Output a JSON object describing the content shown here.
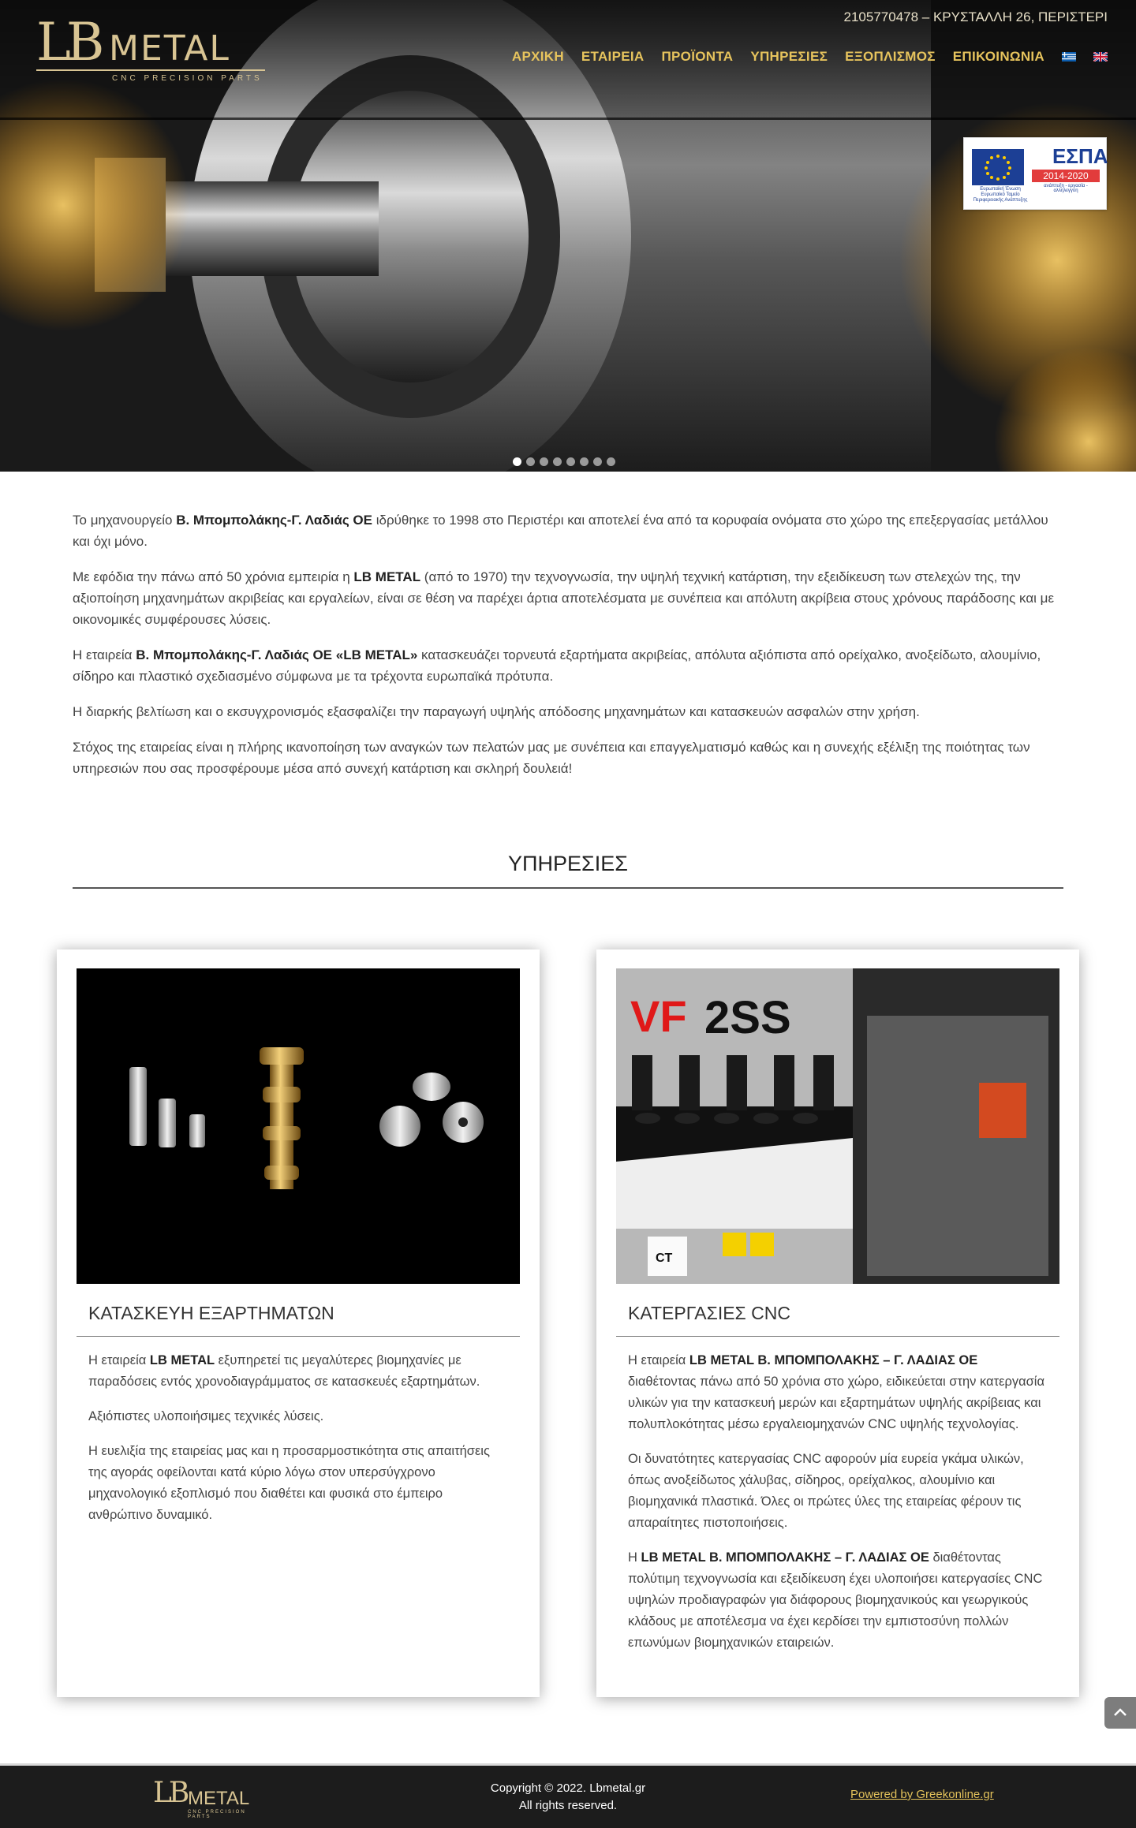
{
  "header": {
    "contact": "2105770478 – ΚΡΥΣΤΑΛΛΗ 26, ΠΕΡΙΣΤΕΡΙ",
    "logo": {
      "mark": "LB",
      "word": "METAL",
      "tagline": "CNC PRECISION PARTS"
    },
    "nav": [
      "ΑΡΧΙΚΗ",
      "ΕΤΑΙΡΕΙΑ",
      "ΠΡΟΪΟΝΤΑ",
      "ΥΠΗΡΕΣΙΕΣ",
      "ΕΞΟΠΛΙΣΜΟΣ",
      "ΕΠΙΚΟΙΝΩΝΙΑ"
    ],
    "languages": [
      "el-flag-icon",
      "en-flag-icon"
    ]
  },
  "espa": {
    "title": "ΕΣΠΑ",
    "years": "2014-2020",
    "eu_caption": "Ευρωπαϊκή Ένωση Ευρωπαϊκό Ταμείο Περιφερειακής Ανάπτυξης",
    "slogan": "ανάπτυξη - εργασία - αλληλεγγύη"
  },
  "slider": {
    "count": 8,
    "active": 0
  },
  "intro": [
    {
      "pre": "Το μηχανουργείο ",
      "bold": "Β. Μπομπολάκης-Γ. Λαδιάς ΟΕ",
      "post": " ιδρύθηκε το 1998 στο Περιστέρι και αποτελεί ένα από τα κορυφαία ονόματα στο χώρο της επεξεργασίας μετάλλου και όχι μόνο."
    },
    {
      "pre": "Με εφόδια την πάνω από 50 χρόνια εμπειρία η ",
      "bold": "LB METAL",
      "post": " (από το 1970) την τεχνογνωσία, την υψηλή τεχνική κατάρτιση, την εξειδίκευση των στελεχών της, την αξιοποίηση μηχανημάτων ακριβείας και εργαλείων, είναι σε θέση να παρέχει άρτια αποτελέσματα με συνέπεια και απόλυτη ακρίβεια στους χρόνους παράδοσης και με οικονομικές συμφέρουσες λύσεις."
    },
    {
      "pre": "Η εταιρεία ",
      "bold": "Β. Μπομπολάκης-Γ. Λαδιάς ΟΕ «LB METAL»",
      "post": " κατασκευάζει τορνευτά εξαρτήματα ακριβείας, απόλυτα αξιόπιστα από ορείχαλκο, ανοξείδωτο, αλουμίνιο, σίδηρο και πλαστικό σχεδιασμένο σύμφωνα με τα τρέχοντα ευρωπαϊκά πρότυπα."
    },
    {
      "pre": "Η διαρκής βελτίωση και ο εκσυγχρονισμός εξασφαλίζει την παραγωγή υψηλής απόδοσης μηχανημάτων και κατασκευών ασφαλών στην χρήση.",
      "bold": "",
      "post": ""
    },
    {
      "pre": "Στόχος της εταιρείας είναι η πλήρης ικανοποίηση των αναγκών των πελατών μας με συνέπεια και επαγγελματισμό καθώς και η συνεχής εξέλιξη της ποιότητας των υπηρεσιών που σας προσφέρουμε μέσα από συνεχή κατάρτιση και σκληρή δουλειά!",
      "bold": "",
      "post": ""
    }
  ],
  "services": {
    "title": "ΥΠΗΡΕΣΙΕΣ",
    "cards": [
      {
        "heading": "ΚΑΤΑΣΚΕΥΗ ΕΞΑΡΤΗΜΑΤΩΝ",
        "paragraphs": [
          {
            "pre": "Η εταιρεία ",
            "bold": "LB METAL",
            "post": " εξυπηρετεί τις μεγαλύτερες βιομηχανίες με παραδόσεις εντός χρονοδιαγράμματος σε κατασκευές εξαρτημάτων."
          },
          {
            "pre": "Αξιόπιστες υλοποιήσιμες τεχνικές λύσεις.",
            "bold": "",
            "post": ""
          },
          {
            "pre": "Η ευελιξία της εταιρείας μας και η προσαρμοστικότητα στις απαιτήσεις της αγοράς οφείλονται κατά κύριο λόγω στον υπερσύγχρονο μηχανολογικό εξοπλισμό που διαθέτει και φυσικά στο έμπειρο ανθρώπινο δυναμικό.",
            "bold": "",
            "post": ""
          }
        ]
      },
      {
        "heading": "ΚΑΤΕΡΓΑΣΙΕΣ CNC",
        "image_text": {
          "vf": "VF",
          "model": "2SS",
          "ct": "CT"
        },
        "paragraphs": [
          {
            "pre": "Η εταιρεία ",
            "bold": "LB METAL Β. ΜΠΟΜΠΟΛΑΚΗΣ – Γ. ΛΑΔΙΑΣ ΟΕ",
            "post": " διαθέτοντας πάνω από 50 χρόνια στο χώρο, ειδικεύεται στην κατεργασία υλικών για την κατασκευή μερών και εξαρτημάτων υψηλής ακρίβειας και πολυπλοκότητας μέσω εργαλειομηχανών CNC υψηλής τεχνολογίας."
          },
          {
            "pre": "Οι δυνατότητες κατεργασίας CNC αφορούν μία ευρεία γκάμα υλικών, όπως ανοξείδωτος χάλυβας, σίδηρος, ορείχαλκος, αλουμίνιο και βιομηχανικά πλαστικά. Όλες οι πρώτες ύλες της εταιρείας φέρουν τις απαραίτητες πιστοποιήσεις.",
            "bold": "",
            "post": ""
          },
          {
            "pre": "Η ",
            "bold": "LB METAL Β. ΜΠΟΜΠΟΛΑΚΗΣ – Γ. ΛΑΔΙΑΣ ΟΕ",
            "post": " διαθέτοντας πολύτιμη τεχνογνωσία και εξειδίκευση έχει υλοποιήσει κατεργασίες CNC υψηλών προδιαγραφών για διάφορους βιομηχανικούς και γεωργικούς κλάδους με αποτέλεσμα να έχει κερδίσει την εμπιστοσύνη πολλών επωνύμων βιομηχανικών εταιρειών."
          }
        ]
      }
    ]
  },
  "footer": {
    "copyright": "Copyright © 2022. Lbmetal.gr",
    "rights": "All rights reserved.",
    "powered": "Powered by Greekonline.gr"
  },
  "colors": {
    "nav": "#e7c45d",
    "gold": "#d8c493",
    "footer_bg": "#1c1c1c"
  }
}
